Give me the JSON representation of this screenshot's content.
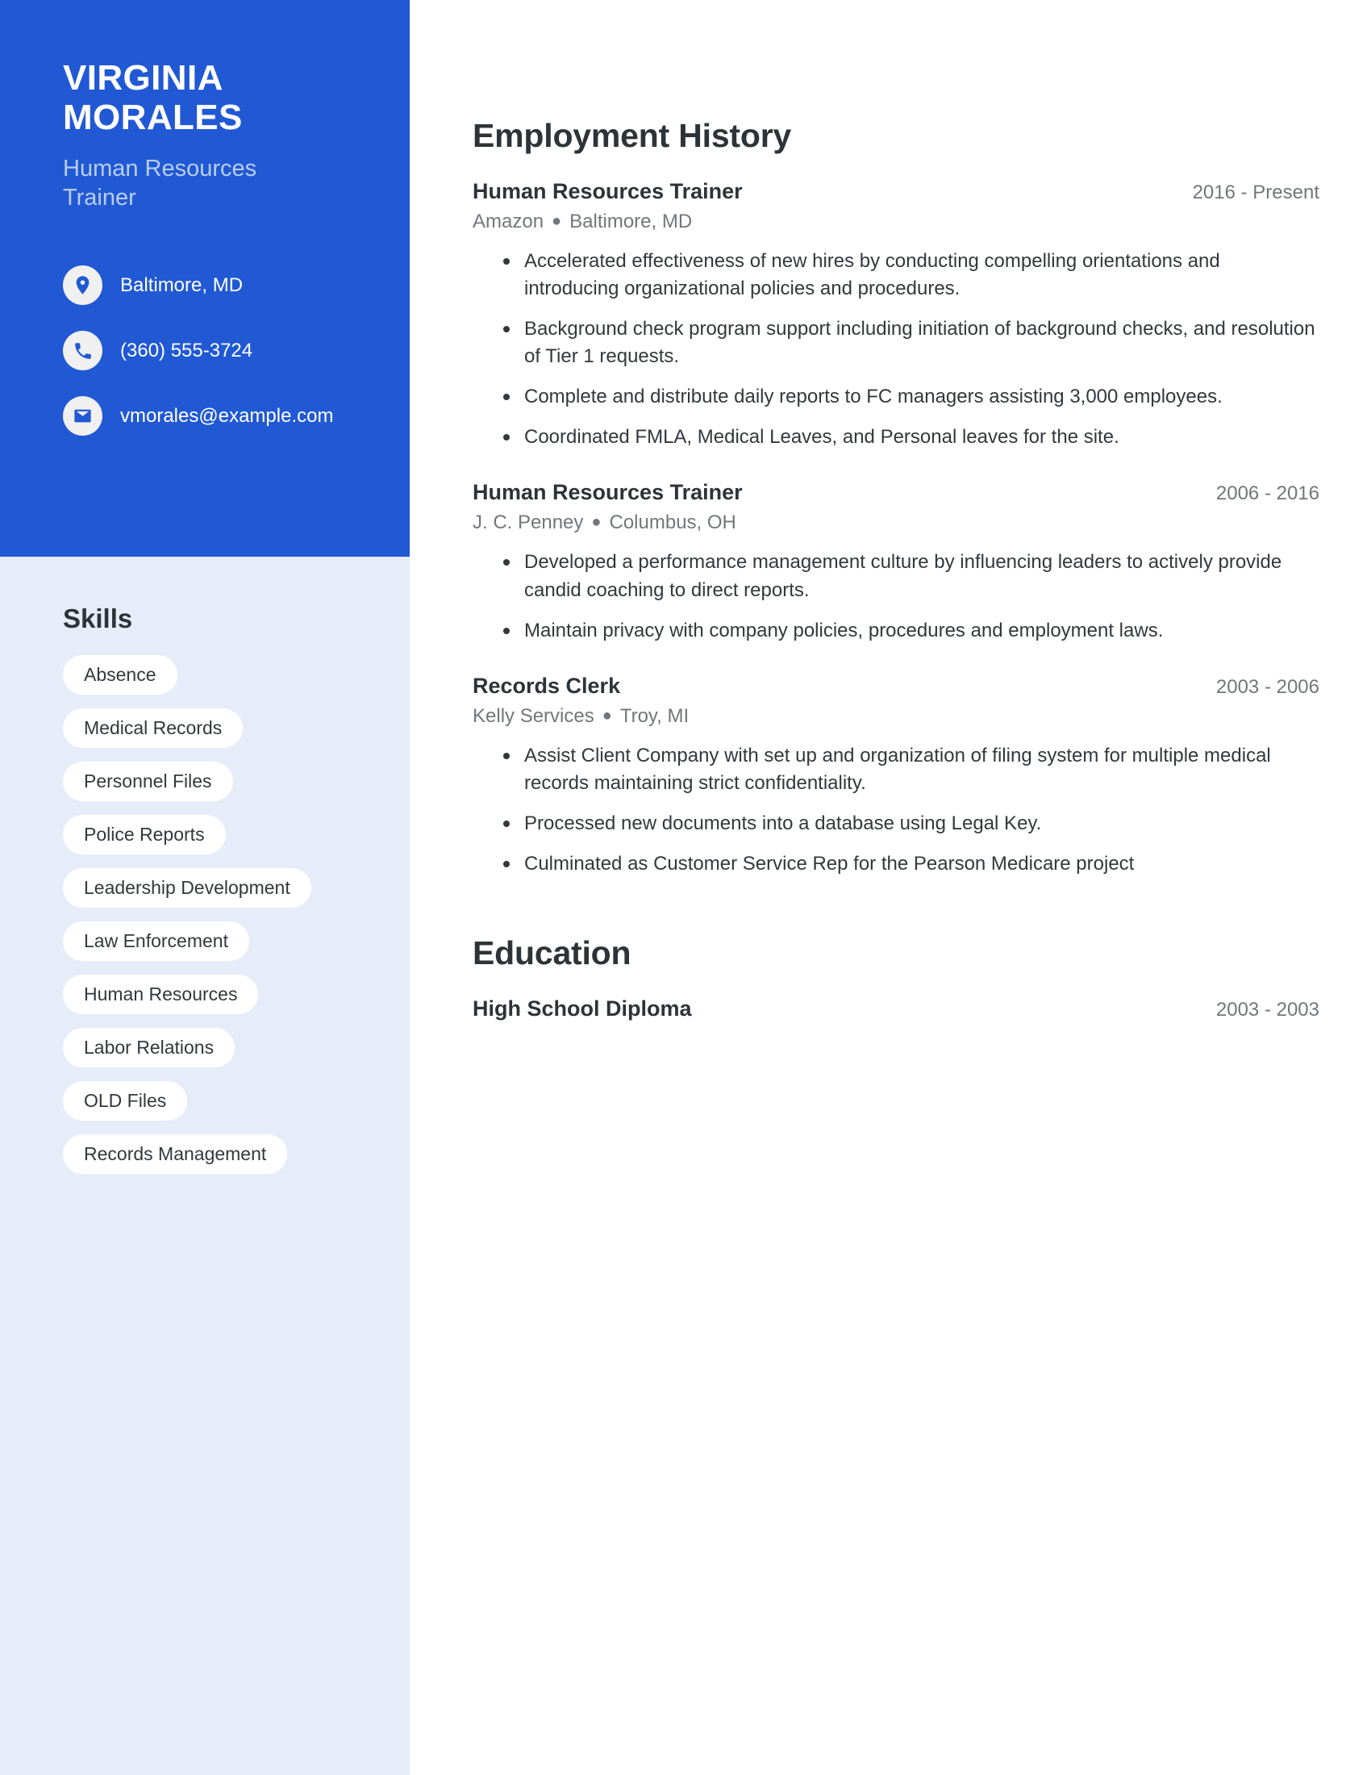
{
  "theme": {
    "accent_blue": "#2159d4",
    "sidebar_light": "#e6edf9",
    "subtitle_blue": "#b9cdf0",
    "text_dark": "#2e3338",
    "text_muted": "#72767b"
  },
  "header": {
    "name": "VIRGINIA\nMORALES",
    "job_title": "Human Resources Trainer"
  },
  "contact": {
    "items": [
      {
        "icon": "location-pin-icon",
        "value": "Baltimore, MD"
      },
      {
        "icon": "phone-icon",
        "value": "(360) 555-3724"
      },
      {
        "icon": "email-icon",
        "value": "vmorales@example.com"
      }
    ]
  },
  "skills": {
    "heading": "Skills",
    "items": [
      "Absence",
      "Medical Records",
      "Personnel Files",
      "Police Reports",
      "Leadership Development",
      "Law Enforcement",
      "Human Resources",
      "Labor Relations",
      "OLD Files",
      "Records Management"
    ]
  },
  "employment": {
    "heading": "Employment History",
    "entries": [
      {
        "role": "Human Resources Trainer",
        "company": "Amazon",
        "location": "Baltimore, MD",
        "dates": "2016 - Present",
        "bullets": [
          "Accelerated effectiveness of new hires by conducting compelling orientations and introducing organizational policies and procedures.",
          "Background check program support including initiation of background checks, and resolution of Tier 1 requests.",
          "Complete and distribute daily reports to FC managers assisting 3,000 employees.",
          "Coordinated FMLA, Medical Leaves, and Personal leaves for the site."
        ]
      },
      {
        "role": "Human Resources Trainer",
        "company": "J. C. Penney",
        "location": "Columbus, OH",
        "dates": "2006 - 2016",
        "bullets": [
          "Developed a performance management culture by influencing leaders to actively provide candid coaching to direct reports.",
          "Maintain privacy with company policies, procedures and employment laws."
        ]
      },
      {
        "role": "Records Clerk",
        "company": "Kelly Services",
        "location": "Troy, MI",
        "dates": "2003 - 2006",
        "bullets": [
          "Assist Client Company with set up and organization of filing system for multiple medical records maintaining strict confidentiality.",
          "Processed new documents into a database using Legal Key.",
          "Culminated as Customer Service Rep for the Pearson Medicare project"
        ]
      }
    ]
  },
  "education": {
    "heading": "Education",
    "entries": [
      {
        "degree": "High School Diploma",
        "dates": "2003 - 2003"
      }
    ]
  }
}
